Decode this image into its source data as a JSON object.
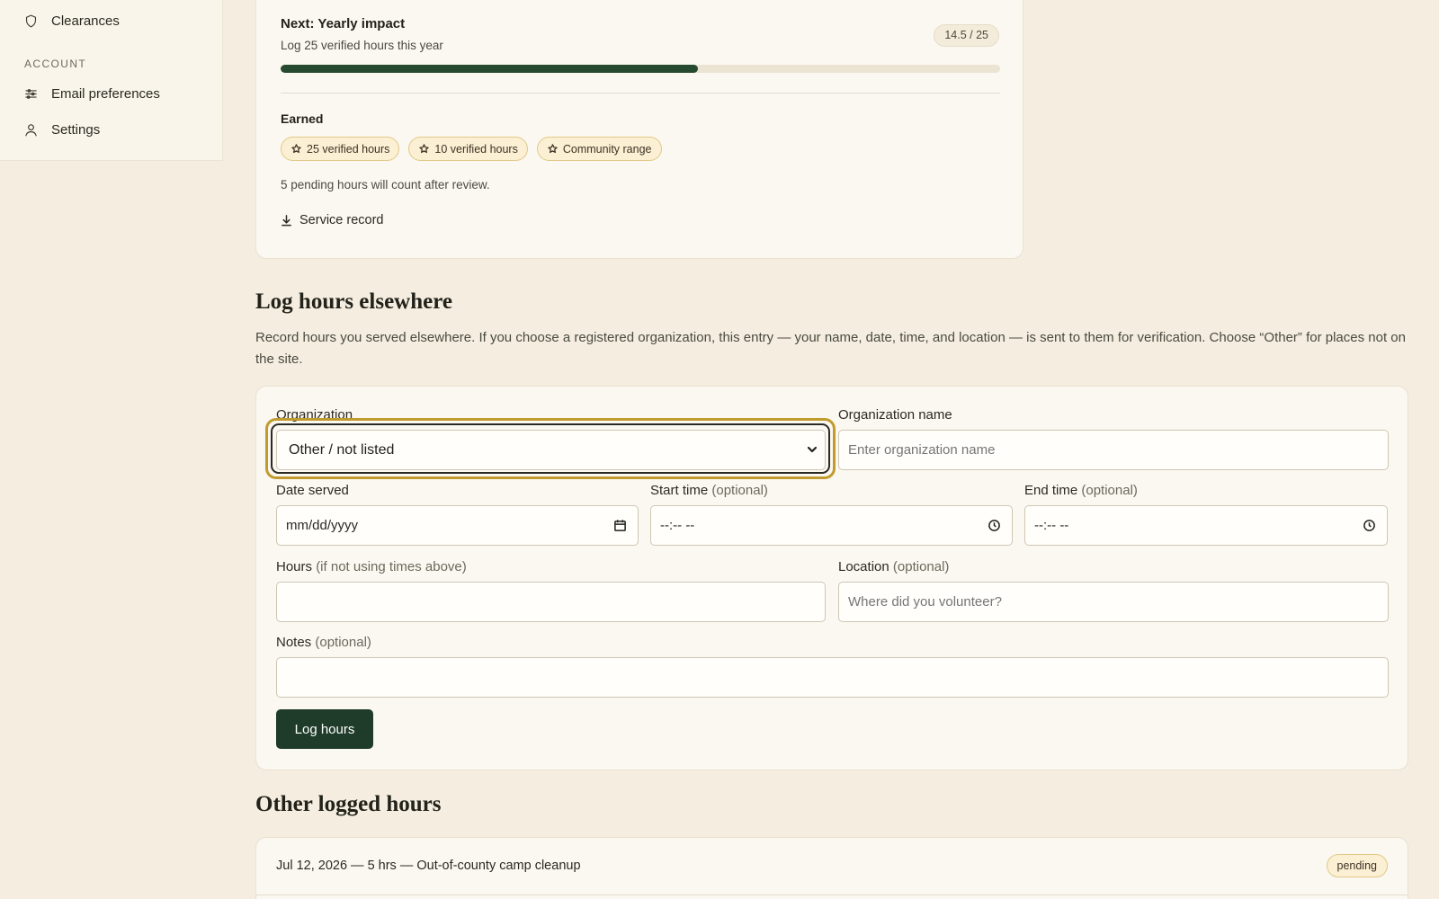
{
  "sidebar": {
    "items": [
      {
        "label": "Clearances",
        "icon": "shield-icon"
      },
      {
        "label": "Email preferences",
        "icon": "sliders-icon"
      },
      {
        "label": "Settings",
        "icon": "user-icon"
      }
    ],
    "section_account": "ACCOUNT"
  },
  "milestone": {
    "title": "Next: Yearly impact",
    "subtitle": "Log 25 verified hours this year",
    "count": "14.5 / 25",
    "progress_fraction": 0.58,
    "earned_label": "Earned",
    "badges": [
      "25 verified hours",
      "10 verified hours",
      "Community range"
    ],
    "pending_note": "5 pending hours will count after review.",
    "service_record": "Service record"
  },
  "log_form": {
    "heading": "Log hours elsewhere",
    "description": "Record hours you served elsewhere. If you choose a registered organization, this entry — your name, date, time, and location — is sent to them for verification. Choose “Other” for places not on the site.",
    "organization_label": "Organization",
    "organization_value": "Other / not listed",
    "org_name_label": "Organization name",
    "org_name_placeholder": "Enter organization name",
    "date_label": "Date served",
    "date_placeholder": "mm/dd/yyyy",
    "start_label": "Start time",
    "end_label": "End time",
    "optional": "(optional)",
    "time_placeholder": "--:-- --",
    "hours_label": "Hours",
    "hours_hint": "(if not using times above)",
    "location_label": "Location",
    "location_placeholder": "Where did you volunteer?",
    "notes_label": "Notes",
    "submit_label": "Log hours"
  },
  "logged": {
    "heading": "Other logged hours",
    "entries": [
      {
        "text": "Jul 12, 2026 — 5 hrs — Out-of-county camp cleanup",
        "status": "pending"
      }
    ]
  },
  "colors": {
    "accent": "#1f3b29",
    "focus_ring": "#c29b2e",
    "badge_bg": "#fbefd4",
    "page_bg": "#f5eee0"
  }
}
